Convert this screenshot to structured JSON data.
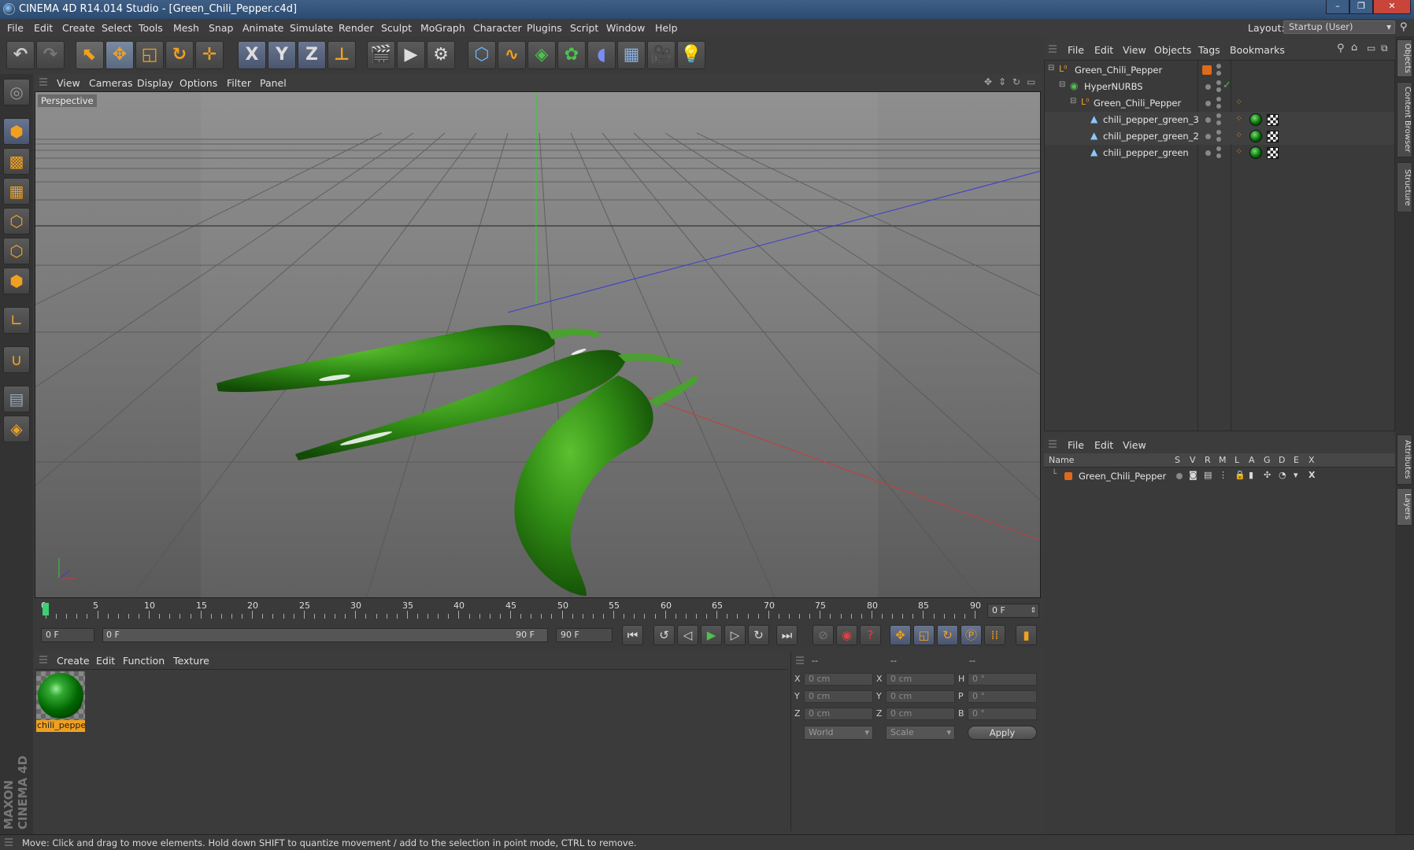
{
  "window": {
    "title": "CINEMA 4D R14.014 Studio - [Green_Chili_Pepper.c4d]",
    "minimize": "–",
    "restore": "❐",
    "close": "✕"
  },
  "menubar": {
    "items": [
      "File",
      "Edit",
      "Create",
      "Select",
      "Tools",
      "Mesh",
      "Snap",
      "Animate",
      "Simulate",
      "Render",
      "Sculpt",
      "MoGraph",
      "Character",
      "Plugins",
      "Script",
      "Window",
      "Help"
    ],
    "layout_label": "Layout:",
    "layout_value": "Startup (User)"
  },
  "toolbar": {
    "axis_x": "X",
    "axis_y": "Y",
    "axis_z": "Z"
  },
  "viewport": {
    "menu": [
      "View",
      "Cameras",
      "Display",
      "Options",
      "Filter",
      "Panel"
    ],
    "label": "Perspective"
  },
  "timeline": {
    "ticks": [
      "0",
      "5",
      "10",
      "15",
      "20",
      "25",
      "30",
      "35",
      "40",
      "45",
      "50",
      "55",
      "60",
      "65",
      "70",
      "75",
      "80",
      "85",
      "90"
    ],
    "current_frame": "0 F",
    "start_field": "0 F",
    "range_start": "0 F",
    "range_end": "90 F",
    "end_field": "90 F"
  },
  "material_manager": {
    "menu": [
      "Create",
      "Edit",
      "Function",
      "Texture"
    ],
    "materials": [
      {
        "name": "chili_peppe"
      }
    ]
  },
  "coordinates": {
    "header": [
      "--",
      "--",
      "--"
    ],
    "rows": [
      {
        "a": "X",
        "pos": "0 cm",
        "b": "X",
        "size": "0 cm",
        "c": "H",
        "rot": "0 °"
      },
      {
        "a": "Y",
        "pos": "0 cm",
        "b": "Y",
        "size": "0 cm",
        "c": "P",
        "rot": "0 °"
      },
      {
        "a": "Z",
        "pos": "0 cm",
        "b": "Z",
        "size": "0 cm",
        "c": "B",
        "rot": "0 °"
      }
    ],
    "mode": "World",
    "scale": "Scale",
    "apply": "Apply"
  },
  "object_manager": {
    "menu": [
      "File",
      "Edit",
      "View",
      "Objects",
      "Tags",
      "Bookmarks"
    ],
    "objects": [
      {
        "name": "Green_Chili_Pepper"
      },
      {
        "name": "HyperNURBS"
      },
      {
        "name": "Green_Chili_Pepper"
      },
      {
        "name": "chili_pepper_green_3"
      },
      {
        "name": "chili_pepper_green_2"
      },
      {
        "name": "chili_pepper_green"
      }
    ]
  },
  "layer_manager": {
    "menu": [
      "File",
      "Edit",
      "View"
    ],
    "columns": [
      "Name",
      "S",
      "V",
      "R",
      "M",
      "L",
      "A",
      "G",
      "D",
      "E",
      "X"
    ],
    "layers": [
      {
        "name": "Green_Chili_Pepper",
        "color": "#e06a1a"
      }
    ]
  },
  "right_tabs": [
    "Objects",
    "Content Browser",
    "Structure",
    "Attributes",
    "Layers"
  ],
  "brand": "MAXON CINEMA 4D",
  "status": "Move: Click and drag to move elements. Hold down SHIFT to quantize movement / add to the selection in point mode, CTRL to remove.",
  "colors": {
    "accent": "#f0a020",
    "pepper": "#2f8a14",
    "axis_x": "#c83c3c",
    "axis_y": "#3cc83c",
    "axis_z": "#4040d0"
  }
}
